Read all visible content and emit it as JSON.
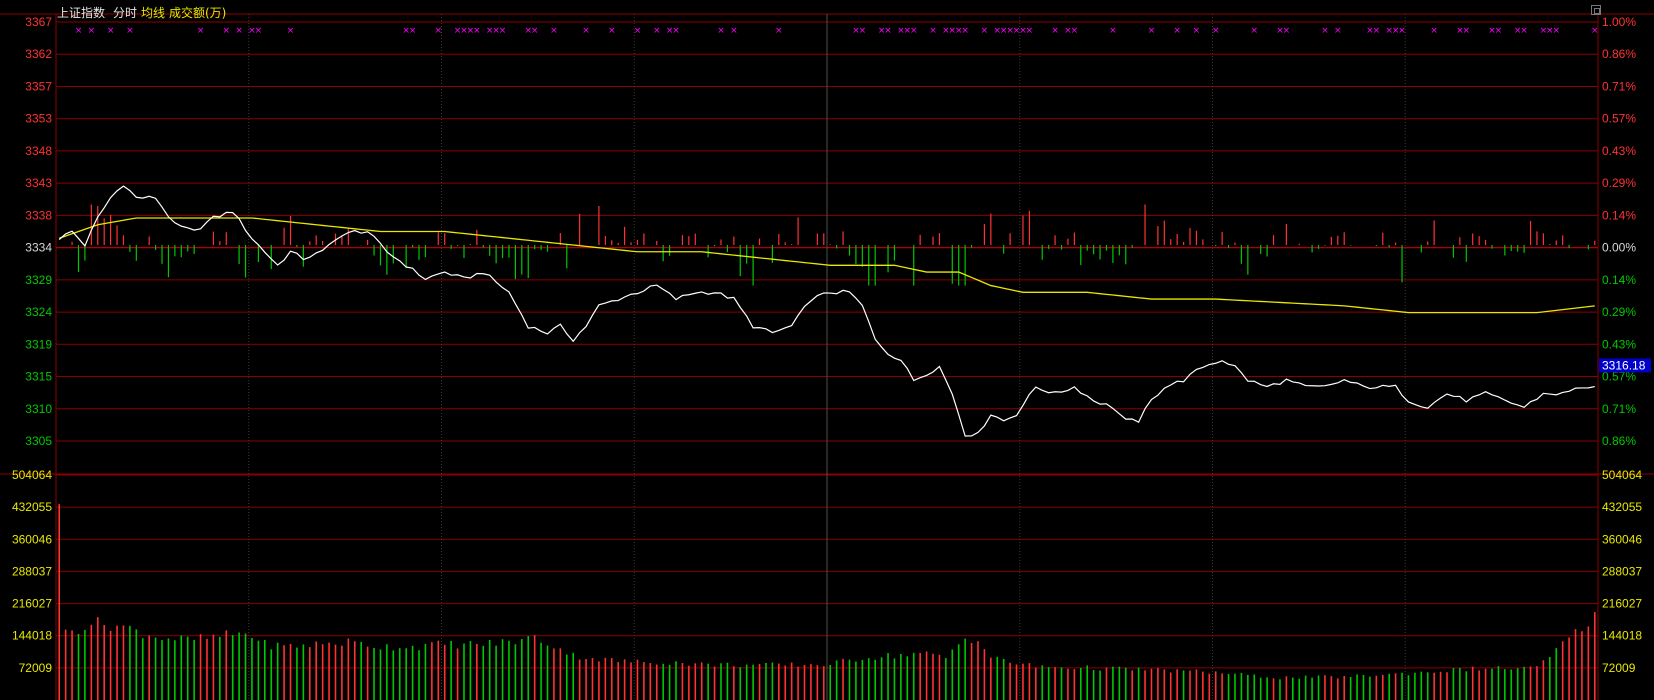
{
  "header": {
    "title": "上证指数",
    "mode_label": "分时",
    "avg_label": "均线",
    "volume_label": "成交额(万)"
  },
  "current_price_tag": "3316.18",
  "colors": {
    "background": "#000000",
    "up": "#ff3232",
    "down": "#00c800",
    "price_line": "#ffffff",
    "avg_line": "#e8e800",
    "grid": "#8a0000",
    "marker": "#ff00ff",
    "price_tag_bg": "#0000c8"
  },
  "chart_data": [
    {
      "type": "line",
      "title": "",
      "x_count": 240,
      "ylim": [
        3305,
        3367
      ],
      "reference_price": 3334,
      "y_ticks_left": [
        "3367",
        "3362",
        "3357",
        "3353",
        "3348",
        "3343",
        "3338",
        "3334",
        "3329",
        "3324",
        "3319",
        "3315",
        "3310",
        "3305"
      ],
      "y_ticks_right": [
        "1.00%",
        "0.86%",
        "0.71%",
        "0.57%",
        "0.43%",
        "0.29%",
        "0.14%",
        "0.00%",
        "0.14%",
        "0.29%",
        "0.43%",
        "0.57%",
        "0.71%",
        "0.86%"
      ],
      "price_keys": [
        [
          0,
          3335
        ],
        [
          2,
          3336
        ],
        [
          4,
          3334
        ],
        [
          6,
          3338
        ],
        [
          8,
          3341
        ],
        [
          10,
          3343
        ],
        [
          12,
          3341
        ],
        [
          15,
          3341
        ],
        [
          18,
          3337
        ],
        [
          21,
          3336
        ],
        [
          24,
          3338
        ],
        [
          27,
          3339
        ],
        [
          30,
          3335
        ],
        [
          32,
          3333
        ],
        [
          34,
          3331
        ],
        [
          36,
          3333
        ],
        [
          38,
          3332
        ],
        [
          41,
          3333
        ],
        [
          43,
          3335
        ],
        [
          46,
          3336
        ],
        [
          48,
          3336
        ],
        [
          51,
          3333
        ],
        [
          54,
          3331
        ],
        [
          57,
          3329
        ],
        [
          60,
          3330
        ],
        [
          63,
          3329
        ],
        [
          66,
          3330
        ],
        [
          70,
          3327
        ],
        [
          73,
          3322
        ],
        [
          76,
          3321
        ],
        [
          78,
          3322
        ],
        [
          80,
          3320
        ],
        [
          82,
          3322
        ],
        [
          84,
          3325
        ],
        [
          87,
          3326
        ],
        [
          90,
          3327
        ],
        [
          93,
          3328
        ],
        [
          96,
          3326
        ],
        [
          99,
          3327
        ],
        [
          102,
          3327
        ],
        [
          105,
          3326
        ],
        [
          108,
          3322
        ],
        [
          111,
          3321
        ],
        [
          114,
          3322
        ],
        [
          117,
          3326
        ],
        [
          120,
          3327
        ],
        [
          123,
          3327
        ],
        [
          125,
          3325
        ],
        [
          127,
          3320
        ],
        [
          129,
          3318
        ],
        [
          131,
          3317
        ],
        [
          133,
          3314
        ],
        [
          135,
          3315
        ],
        [
          137,
          3316
        ],
        [
          139,
          3312
        ],
        [
          141,
          3306
        ],
        [
          143,
          3306
        ],
        [
          145,
          3309
        ],
        [
          147,
          3308
        ],
        [
          149,
          3309
        ],
        [
          152,
          3313
        ],
        [
          155,
          3312
        ],
        [
          158,
          3313
        ],
        [
          161,
          3311
        ],
        [
          164,
          3310
        ],
        [
          166,
          3308
        ],
        [
          168,
          3308
        ],
        [
          170,
          3311
        ],
        [
          172,
          3313
        ],
        [
          175,
          3314
        ],
        [
          178,
          3316
        ],
        [
          181,
          3317
        ],
        [
          183,
          3316
        ],
        [
          185,
          3314
        ],
        [
          188,
          3313
        ],
        [
          191,
          3314
        ],
        [
          194,
          3313
        ],
        [
          197,
          3313
        ],
        [
          200,
          3314
        ],
        [
          203,
          3313
        ],
        [
          206,
          3313
        ],
        [
          208,
          3313
        ],
        [
          210,
          3311
        ],
        [
          213,
          3310
        ],
        [
          216,
          3312
        ],
        [
          219,
          3311
        ],
        [
          222,
          3312
        ],
        [
          225,
          3311
        ],
        [
          228,
          3310
        ],
        [
          231,
          3312
        ],
        [
          234,
          3312
        ],
        [
          237,
          3313
        ],
        [
          239,
          3313
        ]
      ],
      "avg_keys": [
        [
          0,
          3335
        ],
        [
          6,
          3337
        ],
        [
          12,
          3338
        ],
        [
          20,
          3338
        ],
        [
          30,
          3338
        ],
        [
          40,
          3337
        ],
        [
          50,
          3336
        ],
        [
          60,
          3336
        ],
        [
          70,
          3335
        ],
        [
          80,
          3334
        ],
        [
          90,
          3333
        ],
        [
          100,
          3333
        ],
        [
          110,
          3332
        ],
        [
          120,
          3331
        ],
        [
          125,
          3331
        ],
        [
          130,
          3331
        ],
        [
          135,
          3330
        ],
        [
          140,
          3330
        ],
        [
          145,
          3328
        ],
        [
          150,
          3327
        ],
        [
          160,
          3327
        ],
        [
          170,
          3326
        ],
        [
          180,
          3326
        ],
        [
          200,
          3325
        ],
        [
          210,
          3324
        ],
        [
          220,
          3324
        ],
        [
          230,
          3324
        ],
        [
          239,
          3325
        ]
      ]
    },
    {
      "type": "bar",
      "title": "成交额(万)",
      "ylim": [
        0,
        504064
      ],
      "y_ticks": [
        "504064",
        "432055",
        "360046",
        "288037",
        "216027",
        "144018",
        "72009"
      ],
      "volume_keys": [
        [
          0,
          460000
        ],
        [
          1,
          150000
        ],
        [
          3,
          160000
        ],
        [
          5,
          175000
        ],
        [
          7,
          170000
        ],
        [
          10,
          165000
        ],
        [
          13,
          150000
        ],
        [
          16,
          140000
        ],
        [
          20,
          135000
        ],
        [
          24,
          140000
        ],
        [
          28,
          150000
        ],
        [
          30,
          145000
        ],
        [
          32,
          125000
        ],
        [
          35,
          120000
        ],
        [
          40,
          125000
        ],
        [
          45,
          130000
        ],
        [
          50,
          120000
        ],
        [
          55,
          120000
        ],
        [
          60,
          125000
        ],
        [
          65,
          125000
        ],
        [
          70,
          130000
        ],
        [
          74,
          140000
        ],
        [
          78,
          115000
        ],
        [
          80,
          100000
        ],
        [
          85,
          90000
        ],
        [
          90,
          85000
        ],
        [
          95,
          85000
        ],
        [
          100,
          80000
        ],
        [
          110,
          78000
        ],
        [
          120,
          80000
        ],
        [
          125,
          95000
        ],
        [
          130,
          100000
        ],
        [
          134,
          105000
        ],
        [
          138,
          95000
        ],
        [
          141,
          140000
        ],
        [
          143,
          135000
        ],
        [
          145,
          95000
        ],
        [
          148,
          85000
        ],
        [
          152,
          75000
        ],
        [
          160,
          72000
        ],
        [
          170,
          68000
        ],
        [
          175,
          65000
        ],
        [
          180,
          62000
        ],
        [
          185,
          55000
        ],
        [
          190,
          50000
        ],
        [
          200,
          52000
        ],
        [
          210,
          60000
        ],
        [
          220,
          70000
        ],
        [
          230,
          72000
        ],
        [
          236,
          150000
        ],
        [
          239,
          190000
        ]
      ]
    }
  ]
}
